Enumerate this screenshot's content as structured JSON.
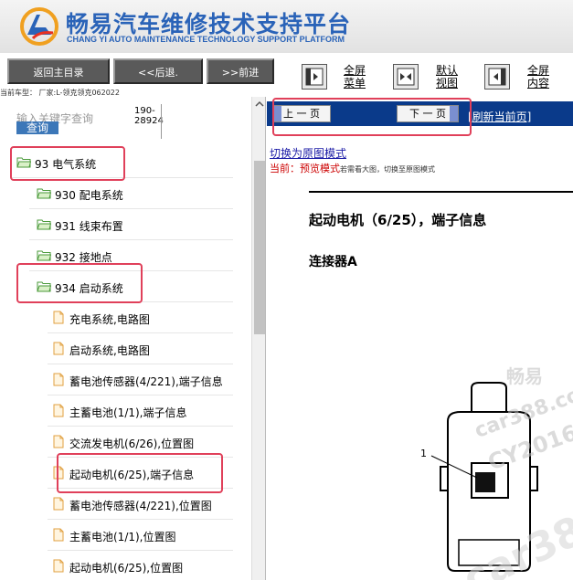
{
  "header": {
    "title_cn": "畅易汽车维修技术支持平台",
    "title_en": "CHANG YI AUTO MAINTENANCE TECHNOLOGY SUPPORT PLATFORM",
    "brand_color": "#2a63b8"
  },
  "toolbar": {
    "home_label": "返回主目录",
    "back_label": "<<后退.",
    "forward_label": ">>前进",
    "fullscreen_menu": [
      "全屏",
      "菜单"
    ],
    "default_view": [
      "默认",
      "视图"
    ],
    "fullscreen_content": [
      "全屏",
      "内容"
    ],
    "car_info": "当前车型： 厂家:L-领克领克062022"
  },
  "search": {
    "placeholder": "输入关键字查询",
    "button_label": "查询",
    "count_line1": "190-",
    "count_line2": "28924"
  },
  "tree": {
    "folders": [
      {
        "label": "93 电气系统"
      },
      {
        "label": "930 配电系统"
      },
      {
        "label": "931 线束布置"
      },
      {
        "label": "932 接地点"
      },
      {
        "label": "934 启动系统"
      }
    ],
    "docs": [
      {
        "label": "充电系统,电路图"
      },
      {
        "label": "启动系统,电路图"
      },
      {
        "label": "蓄电池传感器(4/221),端子信息"
      },
      {
        "label": "主蓄电池(1/1),端子信息"
      },
      {
        "label": "交流发电机(6/26),位置图"
      },
      {
        "label": "起动电机(6/25),端子信息"
      },
      {
        "label": "蓄电池传感器(4/221),位置图"
      },
      {
        "label": "主蓄电池(1/1),位置图"
      },
      {
        "label": "起动电机(6/25),位置图"
      }
    ]
  },
  "viewer": {
    "prev_label": "上 一 页",
    "next_label": "下 一 页",
    "refresh_label": "[刷新当前页]",
    "switch_label": "切换为原图模式",
    "current_prefix": "当前：",
    "current_mode": "预览模式",
    "current_hint": "若需看大图，切换至原图模式",
    "doc_title": "起动电机（6/25），端子信息",
    "connector_title": "连接器A",
    "callout": "1",
    "watermark_1": "畅易",
    "watermark_2": "car388.com",
    "watermark_3": "CY2016",
    "watermark_4": "car388"
  }
}
